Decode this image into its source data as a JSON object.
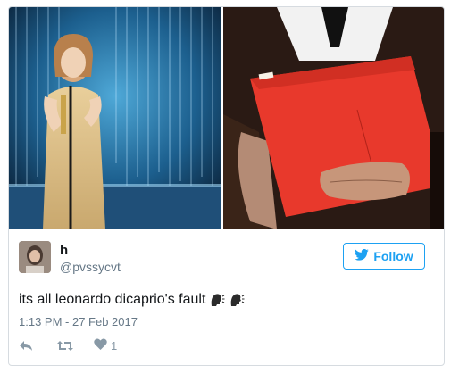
{
  "tweet": {
    "display_name": "h",
    "handle": "@pvssycvt",
    "follow_label": "Follow",
    "text": "its all leonardo dicaprio's fault",
    "emojis": [
      "speaking-head-emoji",
      "speaking-head-emoji"
    ],
    "timestamp": "1:13 PM - 27 Feb 2017",
    "like_count": "1"
  },
  "colors": {
    "accent": "#1da1f2",
    "text": "#14171a",
    "secondary": "#657786",
    "action": "#8899a6",
    "envelope_red": "#e8392c"
  }
}
